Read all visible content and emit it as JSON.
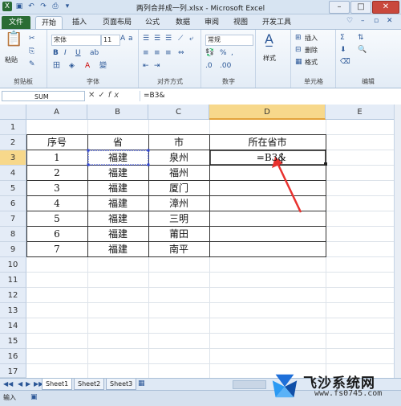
{
  "window": {
    "title": "两列合并成一列.xlsx - Microsoft Excel",
    "min_icon": "minimize-icon",
    "max_icon": "maximize-icon",
    "close_icon": "close-icon"
  },
  "ribbon_tabs": [
    "文件",
    "开始",
    "插入",
    "页面布局",
    "公式",
    "数据",
    "审阅",
    "视图",
    "开发工具"
  ],
  "ribbon": {
    "groups": [
      "剪贴板",
      "字体",
      "对齐方式",
      "数字",
      "单元格",
      "编辑"
    ],
    "paste_label": "粘贴",
    "font_name": "宋体",
    "font_size": "11",
    "number_format": "常规",
    "styles_label": "样式",
    "insert_label": "插入",
    "delete_label": "删除",
    "format_label": "格式",
    "bold": "B",
    "italic": "I",
    "underline": "U",
    "font_color_a": "A",
    "percent": "%"
  },
  "formula_bar": {
    "name_box": "SUM",
    "cancel": "✕",
    "enter": "✓",
    "fx": "fx",
    "formula": "=B3&"
  },
  "columns": [
    "A",
    "B",
    "C",
    "D",
    "E"
  ],
  "rows": [
    "1",
    "2",
    "3",
    "4",
    "5",
    "6",
    "7",
    "8",
    "9",
    "10",
    "11",
    "12",
    "13",
    "14",
    "15",
    "16",
    "17"
  ],
  "table": {
    "headers": [
      "序号",
      "省",
      "市",
      "所在省市"
    ],
    "data": [
      [
        "1",
        "福建",
        "泉州",
        "=B3&"
      ],
      [
        "2",
        "福建",
        "福州",
        ""
      ],
      [
        "3",
        "福建",
        "厦门",
        ""
      ],
      [
        "4",
        "福建",
        "漳州",
        ""
      ],
      [
        "5",
        "福建",
        "三明",
        ""
      ],
      [
        "6",
        "福建",
        "莆田",
        ""
      ],
      [
        "7",
        "福建",
        "南平",
        ""
      ]
    ]
  },
  "sheets": [
    "Sheet1",
    "Sheet2",
    "Sheet3"
  ],
  "status": {
    "mode": "输入"
  },
  "watermark": {
    "title": "飞沙系统网",
    "url": "www.fs0745.com"
  },
  "colors": {
    "accent_file_tab": "#2a6c35",
    "selected_header": "#f7d88b",
    "arrow": "#e8322f"
  }
}
